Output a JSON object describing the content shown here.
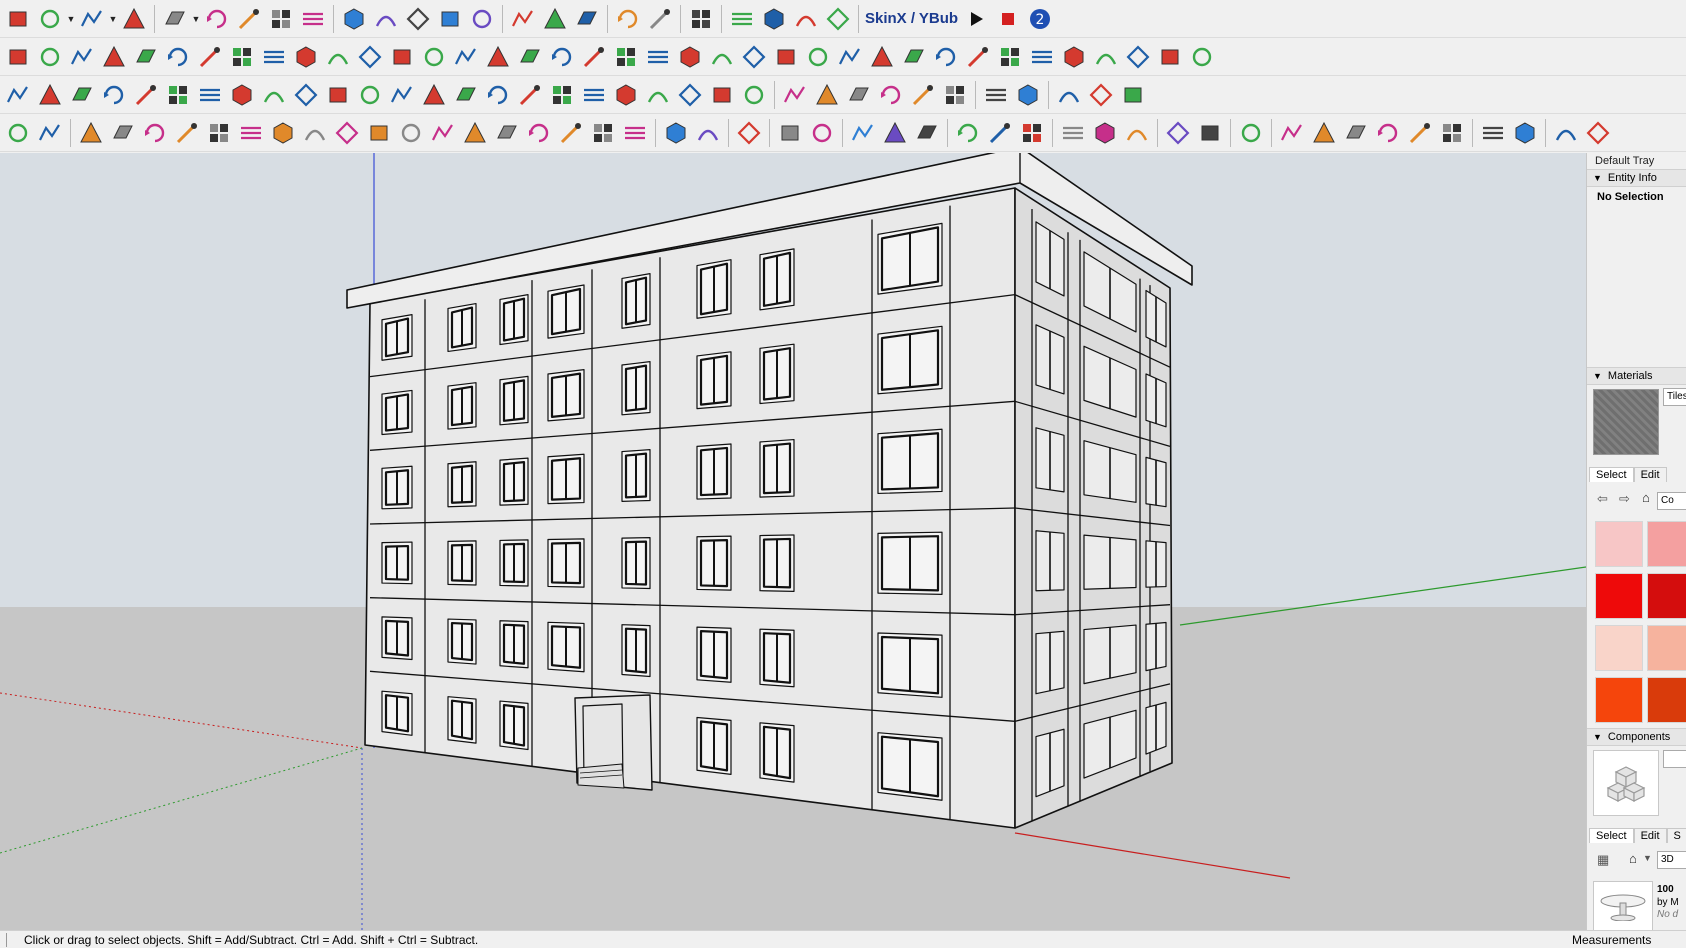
{
  "toolbar": {
    "skin_label_line1": "SkinX / YBub"
  },
  "tray": {
    "title": "Default Tray",
    "entity_info": {
      "label": "Entity Info",
      "selection": "No Selection"
    },
    "materials": {
      "label": "Materials",
      "name_field": "Tiles",
      "tab_select": "Select",
      "tab_edit": "Edit",
      "collection_field": "Co",
      "swatch_colors": [
        "#f7c6c6",
        "#f4a0a0",
        "#ee0a0a",
        "#d40d0d",
        "#f9d4c9",
        "#f6b39e",
        "#f5450c",
        "#d93b0b"
      ]
    },
    "components": {
      "label": "Components",
      "tab_select": "Select",
      "tab_edit": "Edit",
      "tab_stats": "S",
      "search_field": "3D",
      "item_title": "100",
      "item_sub": "by M",
      "item_sub2": "No d"
    }
  },
  "status": {
    "hint": "Click or drag to select objects. Shift = Add/Subtract. Ctrl = Add. Shift + Ctrl = Subtract.",
    "measurements_label": "Measurements"
  },
  "colors": {
    "axis_blue": "#3a4dd6",
    "axis_red": "#c81e1e",
    "axis_green": "#2d9a2d",
    "sky": "#d7dde3",
    "ground": "#c6c6c6",
    "building": "#e9e9e9"
  }
}
